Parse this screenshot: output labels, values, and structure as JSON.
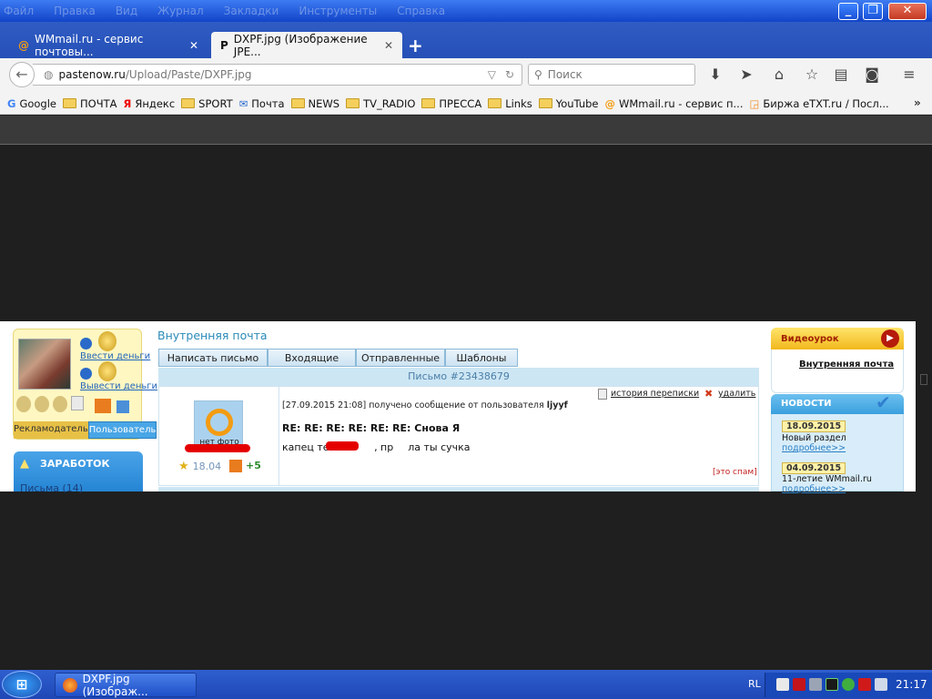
{
  "menu": [
    "Файл",
    "Правка",
    "Вид",
    "Журнал",
    "Закладки",
    "Инструменты",
    "Справка"
  ],
  "window_buttons": {
    "minimize": "_",
    "restore": "❐",
    "close": "✕"
  },
  "tabs": [
    {
      "title": "WMmail.ru - сервис почтовы...",
      "icon": "wmmail-icon",
      "active": false
    },
    {
      "title": "DXPF.jpg (Изображение JPE...",
      "icon": "p-icon",
      "active": true
    }
  ],
  "newtab_label": "+",
  "address": {
    "host": "pastenow.ru",
    "path": "/Upload/Paste/DXPF.jpg"
  },
  "search": {
    "placeholder": "Поиск"
  },
  "bookmarks": [
    {
      "label": "Google",
      "icon": "google-icon"
    },
    {
      "label": "ПОЧТА",
      "icon": "folder-icon"
    },
    {
      "label": "Яндекс",
      "icon": "yandex-icon"
    },
    {
      "label": "SPORT",
      "icon": "folder-icon"
    },
    {
      "label": "Почта",
      "icon": "mail-icon"
    },
    {
      "label": "NEWS",
      "icon": "folder-icon"
    },
    {
      "label": "TV_RADIO",
      "icon": "folder-icon"
    },
    {
      "label": "ПРЕССА",
      "icon": "folder-icon"
    },
    {
      "label": "Links",
      "icon": "folder-icon"
    },
    {
      "label": "YouTube",
      "icon": "folder-icon"
    },
    {
      "label": "WMmail.ru - сервис п...",
      "icon": "wmmail-icon"
    },
    {
      "label": "Биржа eTXT.ru / Посл...",
      "icon": "rss-icon"
    }
  ],
  "bookmarks_more": "»",
  "image": {
    "left": {
      "deposit": "Ввести деньги",
      "withdraw": "Вывести деньги",
      "role_advertiser": "Рекламодатель",
      "role_user": "Пользователь",
      "earnings_header": "ЗАРАБОТОК",
      "earnings_item": "Письма (14)"
    },
    "mail": {
      "title": "Внутренняя почта",
      "tabs": [
        "Написать письмо",
        "Входящие",
        "Отправленные",
        "Шаблоны"
      ],
      "letter_title": "Письмо #23438679",
      "no_photo": "нет фото",
      "rating": "18.04",
      "plus": "+5",
      "meta_prefix": "[27.09.2015 21:08] получено сообщение от пользователя",
      "sender": "ljyyf",
      "history": "история переписки",
      "delete": "удалить",
      "subject": "RE: RE: RE: RE: RE: RE: Снова Я",
      "body_start": "капец тебе",
      "body_mid": ", пр",
      "body_end": "ла ты сучка",
      "spam": "[это спам]"
    },
    "right": {
      "video_header": "Видеоурок",
      "video_link": "Внутренняя почта",
      "news_header": "НОВОСТИ",
      "news": [
        {
          "date": "18.09.2015",
          "text": "Новый раздел",
          "more": "подробнее>>"
        },
        {
          "date": "04.09.2015",
          "text": "11-летие WMmail.ru",
          "more": "подробнее>>"
        }
      ]
    }
  },
  "taskbar": {
    "task_title": "DXPF.jpg (Изображ...",
    "lang": "RL",
    "clock": "21:17"
  }
}
